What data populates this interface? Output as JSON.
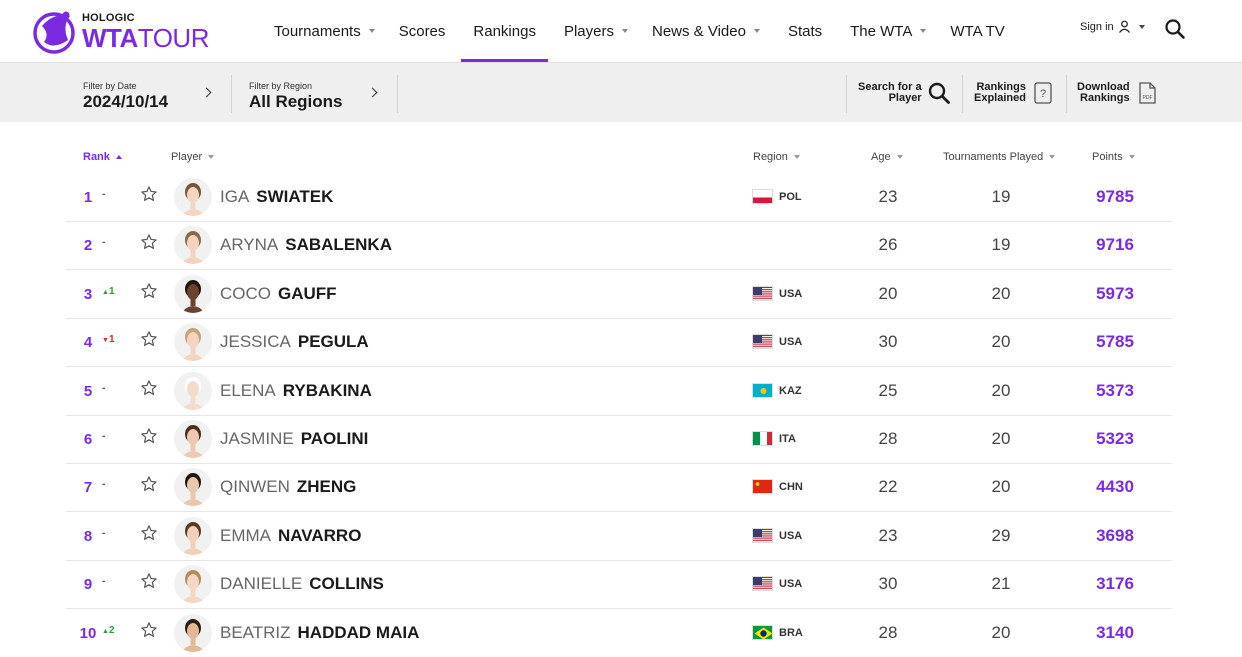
{
  "header": {
    "logo_top": "HOLOGIC",
    "logo_main_bold": "WTA",
    "logo_main": "TOUR",
    "nav": [
      {
        "label": "Tournaments",
        "dropdown": true,
        "active": false
      },
      {
        "label": "Scores",
        "dropdown": false,
        "active": false
      },
      {
        "label": "Rankings",
        "dropdown": false,
        "active": true
      },
      {
        "label": "Players",
        "dropdown": true,
        "active": false
      },
      {
        "label": "News & Video",
        "dropdown": true,
        "active": false
      },
      {
        "label": "Stats",
        "dropdown": false,
        "active": false
      },
      {
        "label": "The WTA",
        "dropdown": true,
        "active": false
      },
      {
        "label": "WTA TV",
        "dropdown": false,
        "active": false
      }
    ],
    "signin": "Sign in"
  },
  "filters": {
    "date_label": "Filter by Date",
    "date_value": "2024/10/14",
    "region_label": "Filter by Region",
    "region_value": "All Regions"
  },
  "tools": {
    "search_line1": "Search for a",
    "search_line2": "Player",
    "explained_line1": "Rankings",
    "explained_line2": "Explained",
    "download_line1": "Download",
    "download_line2": "Rankings"
  },
  "columns": {
    "rank": "Rank",
    "player": "Player",
    "region": "Region",
    "age": "Age",
    "played": "Tournaments Played",
    "points": "Points"
  },
  "rows": [
    {
      "rank": "1",
      "move": "-",
      "move_dir": "none",
      "first": "IGA",
      "last": "SWIATEK",
      "country": "POL",
      "flag": "pol",
      "age": "23",
      "played": "19",
      "points": "9785"
    },
    {
      "rank": "2",
      "move": "-",
      "move_dir": "none",
      "first": "ARYNA",
      "last": "SABALENKA",
      "country": "",
      "flag": "none",
      "age": "26",
      "played": "19",
      "points": "9716"
    },
    {
      "rank": "3",
      "move": "1",
      "move_dir": "up",
      "first": "COCO",
      "last": "GAUFF",
      "country": "USA",
      "flag": "usa",
      "age": "20",
      "played": "20",
      "points": "5973"
    },
    {
      "rank": "4",
      "move": "1",
      "move_dir": "down",
      "first": "JESSICA",
      "last": "PEGULA",
      "country": "USA",
      "flag": "usa",
      "age": "30",
      "played": "20",
      "points": "5785"
    },
    {
      "rank": "5",
      "move": "-",
      "move_dir": "none",
      "first": "ELENA",
      "last": "RYBAKINA",
      "country": "KAZ",
      "flag": "kaz",
      "age": "25",
      "played": "20",
      "points": "5373"
    },
    {
      "rank": "6",
      "move": "-",
      "move_dir": "none",
      "first": "JASMINE",
      "last": "PAOLINI",
      "country": "ITA",
      "flag": "ita",
      "age": "28",
      "played": "20",
      "points": "5323"
    },
    {
      "rank": "7",
      "move": "-",
      "move_dir": "none",
      "first": "QINWEN",
      "last": "ZHENG",
      "country": "CHN",
      "flag": "chn",
      "age": "22",
      "played": "20",
      "points": "4430"
    },
    {
      "rank": "8",
      "move": "-",
      "move_dir": "none",
      "first": "EMMA",
      "last": "NAVARRO",
      "country": "USA",
      "flag": "usa",
      "age": "23",
      "played": "29",
      "points": "3698"
    },
    {
      "rank": "9",
      "move": "-",
      "move_dir": "none",
      "first": "DANIELLE",
      "last": "COLLINS",
      "country": "USA",
      "flag": "usa",
      "age": "30",
      "played": "21",
      "points": "3176"
    },
    {
      "rank": "10",
      "move": "2",
      "move_dir": "up",
      "first": "BEATRIZ",
      "last": "HADDAD MAIA",
      "country": "BRA",
      "flag": "bra",
      "age": "28",
      "played": "20",
      "points": "3140"
    }
  ],
  "colors": {
    "accent": "#7a2be2",
    "up": "#2a9d3a",
    "down": "#d42a2a"
  }
}
